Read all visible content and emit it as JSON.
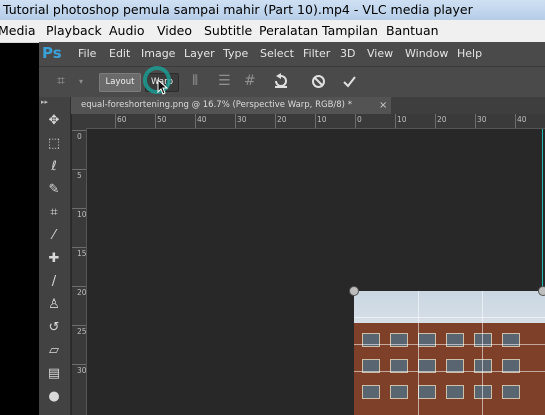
{
  "window": {
    "title": "Tutorial photoshop pemula sampai mahir (Part 10).mp4 - VLC media player"
  },
  "vlc_menu": [
    "Media",
    "Playback",
    "Audio",
    "Video",
    "Subtitle",
    "Peralatan",
    "Tampilan",
    "Bantuan"
  ],
  "ps": {
    "logo": "Ps",
    "menu": [
      "File",
      "Edit",
      "Image",
      "Layer",
      "Type",
      "Select",
      "Filter",
      "3D",
      "View",
      "Window",
      "Help"
    ],
    "options": {
      "layout_label": "Layout",
      "warp_label": "Warp"
    },
    "document_tab": "equal-foreshortening.png @ 16.7% (Perspective Warp, RGB/8) *",
    "tab_close": "×",
    "ruler_h_labels": [
      "60",
      "50",
      "40",
      "30",
      "20",
      "10",
      "0",
      "10",
      "20",
      "30",
      "40"
    ],
    "ruler_v_labels": [
      "0",
      "5",
      "10",
      "15",
      "20",
      "25",
      "30"
    ]
  },
  "icons": {
    "undo": "undo-icon",
    "cancel": "cancel-icon",
    "commit": "checkmark-icon",
    "tools": [
      "move-tool-icon",
      "marquee-tool-icon",
      "lasso-tool-icon",
      "quick-select-icon",
      "crop-tool-icon",
      "eyedropper-icon",
      "healing-brush-icon",
      "brush-icon",
      "clone-stamp-icon",
      "history-brush-icon",
      "eraser-icon",
      "gradient-icon",
      "blur-tool-icon"
    ]
  }
}
